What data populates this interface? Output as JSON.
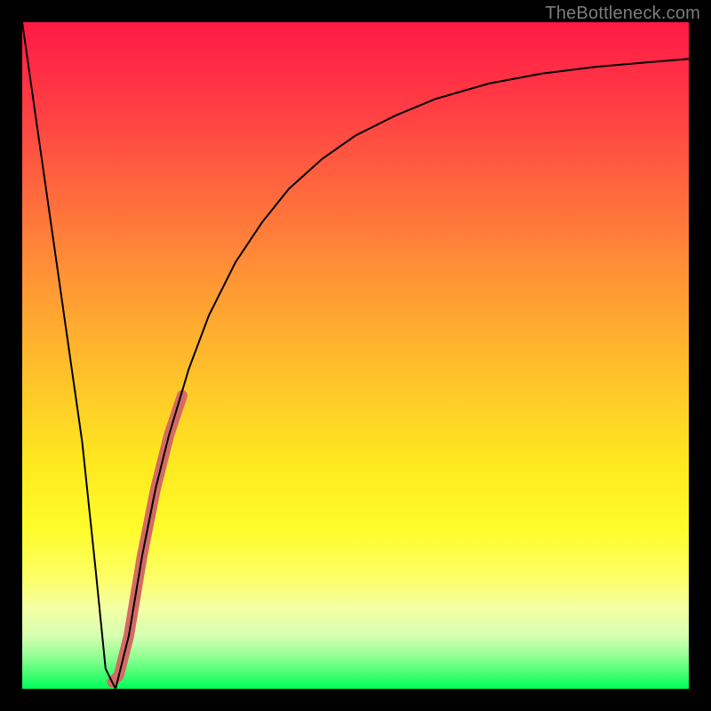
{
  "watermark": "TheBottleneck.com",
  "chart_data": {
    "type": "line",
    "title": "",
    "xlabel": "",
    "ylabel": "",
    "xlim": [
      0,
      100
    ],
    "ylim": [
      0,
      100
    ],
    "grid": false,
    "series": [
      {
        "name": "bottleneck-curve",
        "color": "#000000",
        "stroke_width": 2,
        "x": [
          0,
          3,
          6,
          9,
          11,
          12.5,
          14,
          16,
          18,
          20,
          22,
          25,
          28,
          32,
          36,
          40,
          45,
          50,
          56,
          62,
          70,
          78,
          86,
          94,
          100
        ],
        "values": [
          100,
          79,
          58,
          37,
          18,
          3,
          0,
          8,
          20,
          30,
          38,
          48,
          56,
          64,
          70,
          75,
          79.5,
          83,
          86,
          88.5,
          90.8,
          92.3,
          93.3,
          94,
          94.5
        ]
      },
      {
        "name": "highlight-segment",
        "color": "#d46a64",
        "stroke_width": 12,
        "linecap": "round",
        "x": [
          13.5,
          14.5,
          16,
          18,
          20,
          22,
          24
        ],
        "values": [
          1,
          2,
          8,
          20,
          30,
          38,
          44
        ]
      }
    ],
    "background_gradient": {
      "top": "#ff1a46",
      "bottom": "#00ff5a"
    }
  }
}
